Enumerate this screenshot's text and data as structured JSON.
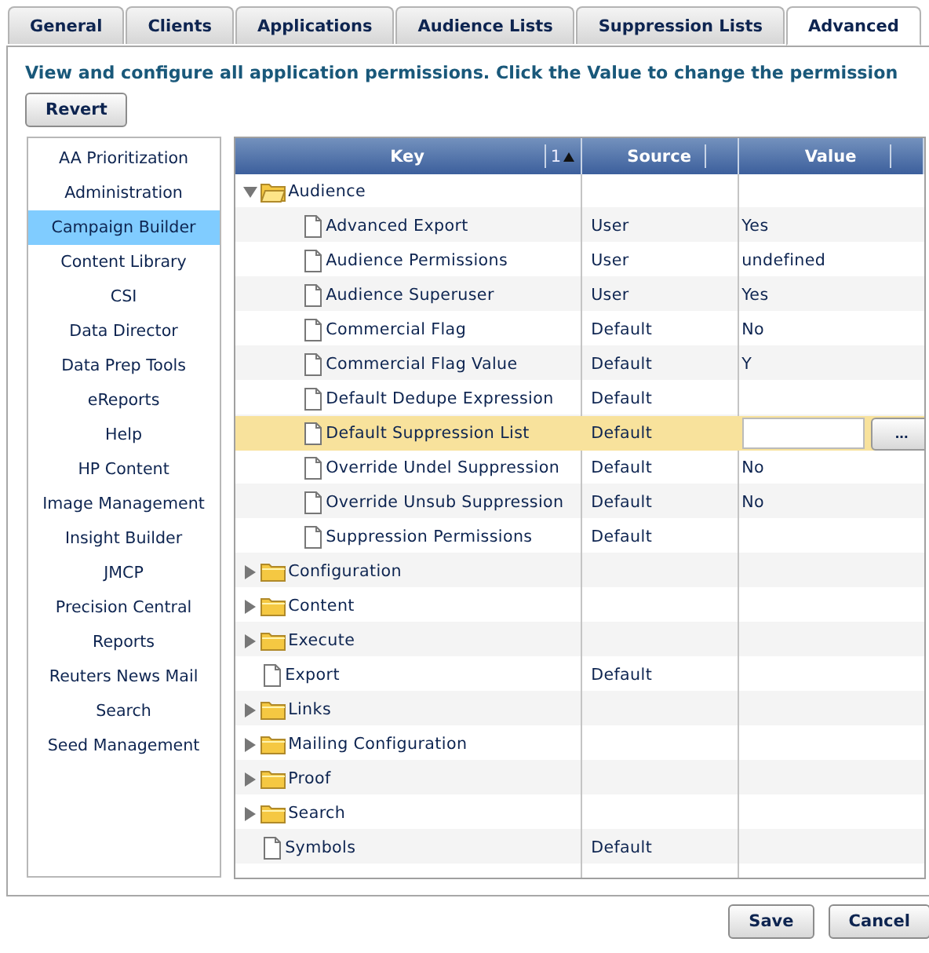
{
  "tabs": [
    {
      "label": "General",
      "selected": false
    },
    {
      "label": "Clients",
      "selected": false
    },
    {
      "label": "Applications",
      "selected": false
    },
    {
      "label": "Audience Lists",
      "selected": false
    },
    {
      "label": "Suppression Lists",
      "selected": false
    },
    {
      "label": "Advanced",
      "selected": true
    }
  ],
  "heading": "View and configure all application permissions. Click the Value to change the permission",
  "revert_button": "Revert",
  "sidebar": {
    "items": [
      {
        "label": "AA Prioritization",
        "selected": false
      },
      {
        "label": "Administration",
        "selected": false
      },
      {
        "label": "Campaign Builder",
        "selected": true
      },
      {
        "label": "Content Library",
        "selected": false
      },
      {
        "label": "CSI",
        "selected": false
      },
      {
        "label": "Data Director",
        "selected": false
      },
      {
        "label": "Data Prep Tools",
        "selected": false
      },
      {
        "label": "eReports",
        "selected": false
      },
      {
        "label": "Help",
        "selected": false
      },
      {
        "label": "HP Content",
        "selected": false
      },
      {
        "label": "Image Management",
        "selected": false
      },
      {
        "label": "Insight Builder",
        "selected": false
      },
      {
        "label": "JMCP",
        "selected": false
      },
      {
        "label": "Precision Central",
        "selected": false
      },
      {
        "label": "Reports",
        "selected": false
      },
      {
        "label": "Reuters News Mail",
        "selected": false
      },
      {
        "label": "Search",
        "selected": false
      },
      {
        "label": "Seed Management",
        "selected": false
      }
    ]
  },
  "table": {
    "columns": [
      {
        "label": "Key",
        "sort_order": "1",
        "ascending": true
      },
      {
        "label": "Source"
      },
      {
        "label": "Value"
      }
    ],
    "rows": [
      {
        "kind": "folder",
        "key": "Audience",
        "expanded": true,
        "selected": false,
        "children": [
          {
            "kind": "item",
            "key": "Advanced Export",
            "source": "User",
            "value": "Yes",
            "selected": false
          },
          {
            "kind": "item",
            "key": "Audience Permissions",
            "source": "User",
            "value": "undefined",
            "selected": false
          },
          {
            "kind": "item",
            "key": "Audience Superuser",
            "source": "User",
            "value": "Yes",
            "selected": false
          },
          {
            "kind": "item",
            "key": "Commercial Flag",
            "source": "Default",
            "value": "No",
            "selected": false
          },
          {
            "kind": "item",
            "key": "Commercial Flag Value",
            "source": "Default",
            "value": "Y",
            "selected": false
          },
          {
            "kind": "item",
            "key": "Default Dedupe Expression",
            "source": "Default",
            "selected": false
          },
          {
            "kind": "item",
            "key": "Default Suppression List",
            "source": "Default",
            "selected": true,
            "browse_button": "..."
          },
          {
            "kind": "item",
            "key": "Override Undel Suppression",
            "source": "Default",
            "value": "No",
            "selected": false
          },
          {
            "kind": "item",
            "key": "Override Unsub Suppression",
            "source": "Default",
            "value": "No",
            "selected": false
          },
          {
            "kind": "item",
            "key": "Suppression Permissions",
            "source": "Default",
            "selected": false
          }
        ]
      },
      {
        "kind": "folder",
        "key": "Configuration",
        "expanded": false,
        "selected": false
      },
      {
        "kind": "folder",
        "key": "Content",
        "expanded": false,
        "selected": false
      },
      {
        "kind": "folder",
        "key": "Execute",
        "expanded": false,
        "selected": false
      },
      {
        "kind": "item",
        "key": "Export",
        "source": "Default",
        "selected": false
      },
      {
        "kind": "folder",
        "key": "Links",
        "expanded": false,
        "selected": false
      },
      {
        "kind": "folder",
        "key": "Mailing Configuration",
        "expanded": false,
        "selected": false
      },
      {
        "kind": "folder",
        "key": "Proof",
        "expanded": false,
        "selected": false
      },
      {
        "kind": "folder",
        "key": "Search",
        "expanded": false,
        "selected": false
      },
      {
        "kind": "item",
        "key": "Symbols",
        "source": "Default",
        "selected": false
      }
    ]
  },
  "buttons": [
    {
      "label": "Save"
    },
    {
      "label": "Cancel"
    }
  ]
}
